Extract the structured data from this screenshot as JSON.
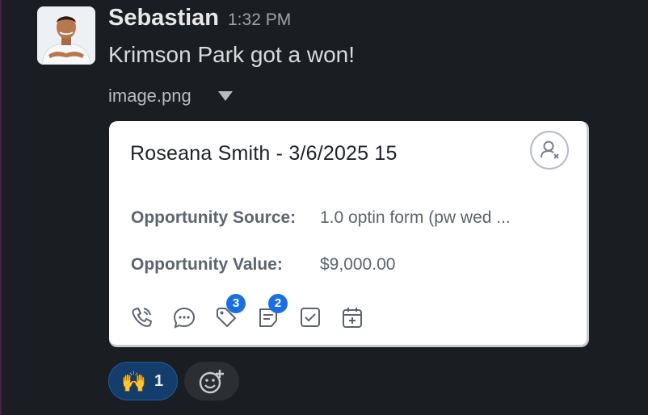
{
  "message": {
    "sender": "Sebastian",
    "time": "1:32 PM",
    "text": "Krimson Park got a won!",
    "attachment": {
      "filename": "image.png",
      "toggle_icon": "caret-down-icon"
    }
  },
  "card": {
    "title": "Roseana Smith - 3/6/2025 15",
    "close_icon": "unassign-user-icon",
    "fields": [
      {
        "label": "Opportunity Source:",
        "value": "1.0 optin form (pw wed ..."
      },
      {
        "label": "Opportunity Value:",
        "value": "$9,000.00"
      }
    ],
    "actions": [
      {
        "icon": "phone-icon"
      },
      {
        "icon": "chat-icon"
      },
      {
        "icon": "tag-icon",
        "badge": "3"
      },
      {
        "icon": "note-icon",
        "badge": "2"
      },
      {
        "icon": "task-checkbox-icon"
      },
      {
        "icon": "calendar-add-icon"
      }
    ]
  },
  "reactions": [
    {
      "emoji": "🙌",
      "count": "1"
    }
  ],
  "colors": {
    "background": "#1a1d21",
    "reaction_bg": "#153d6b",
    "badge": "#1a6fe0"
  }
}
